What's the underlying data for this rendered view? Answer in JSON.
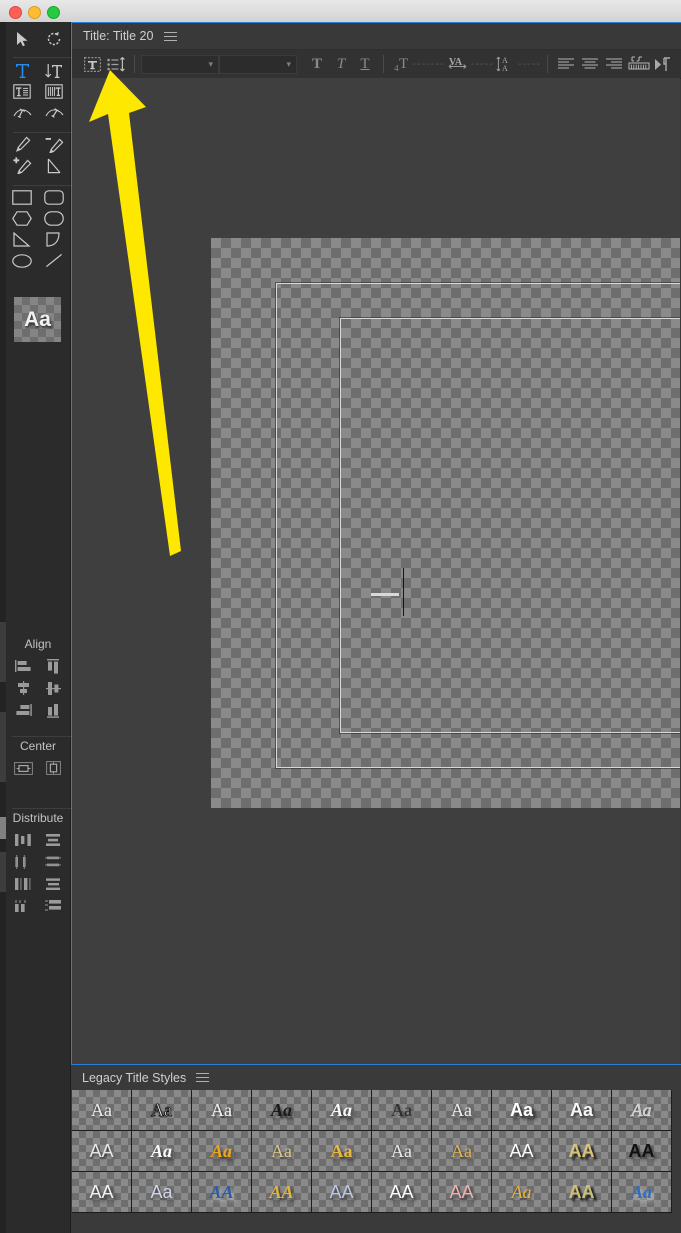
{
  "window": {
    "os_controls": [
      "close",
      "minimize",
      "zoom"
    ]
  },
  "titler": {
    "header": {
      "title": "Title: Title 20",
      "menu_icon": "hamburger-menu-icon"
    },
    "toolbar": {
      "buttons": [
        {
          "name": "title-tool-icon",
          "label": "T"
        },
        {
          "name": "tab-stops-icon",
          "label": ""
        }
      ],
      "font_family_value": "",
      "font_style_value": "",
      "bold_label": "T",
      "italic_label": "T",
      "underline_label": "T",
      "font_size_label": "T",
      "font_size_value": "-------",
      "kerning_label": "VA",
      "kerning_value": "-----",
      "leading_label": "A",
      "leading_value": "-----",
      "align_left": "align-left-icon",
      "align_center": "align-center-icon",
      "align_right": "align-right-icon",
      "tab_stops": "tab-stops-icon",
      "show_background_video": "show-background-video-icon"
    },
    "canvas": {
      "action_safe_guide": "action-safe-margin",
      "title_safe_guide": "title-safe-margin",
      "text_caret": "text-insertion-caret"
    }
  },
  "tools": {
    "rows": [
      [
        {
          "n": "selection-tool",
          "g": "arrow"
        },
        {
          "n": "rotation-tool",
          "g": "rotate"
        }
      ],
      [
        {
          "n": "type-tool",
          "g": "T",
          "sel": true
        },
        {
          "n": "vertical-type-tool",
          "g": "VT"
        }
      ],
      [
        {
          "n": "area-type-tool",
          "g": "boxT"
        },
        {
          "n": "vertical-area-type-tool",
          "g": "boxVT"
        }
      ],
      [
        {
          "n": "path-type-tool",
          "g": "pathT"
        },
        {
          "n": "vertical-path-type-tool",
          "g": "pathVT"
        }
      ],
      [
        {
          "n": "pen-tool",
          "g": "pen"
        },
        {
          "n": "delete-anchor-point-tool",
          "g": "penminus"
        }
      ],
      [
        {
          "n": "add-anchor-point-tool",
          "g": "penplus"
        },
        {
          "n": "convert-anchor-point-tool",
          "g": "convert"
        }
      ],
      [
        {
          "n": "rectangle-tool",
          "g": "rect"
        },
        {
          "n": "rounded-corner-rectangle-tool",
          "g": "roundrect"
        }
      ],
      [
        {
          "n": "clipped-corner-rectangle-tool",
          "g": "clipped"
        },
        {
          "n": "rounded-rectangle-tool",
          "g": "pill"
        }
      ],
      [
        {
          "n": "wedge-tool",
          "g": "wedge"
        },
        {
          "n": "arc-tool",
          "g": "arc"
        }
      ],
      [
        {
          "n": "ellipse-tool",
          "g": "ellipse"
        },
        {
          "n": "line-tool",
          "g": "line"
        }
      ]
    ],
    "preview_label": "Aa"
  },
  "panels": {
    "align": {
      "heading": "Align",
      "buttons": [
        "align-horizontal-left",
        "align-vertical-top",
        "align-horizontal-center",
        "align-vertical-center",
        "align-horizontal-right",
        "align-vertical-bottom"
      ]
    },
    "center": {
      "heading": "Center",
      "buttons": [
        "center-horizontally",
        "center-vertically"
      ]
    },
    "distribute": {
      "heading": "Distribute",
      "buttons": [
        "distribute-horizontal-left",
        "distribute-vertical-top",
        "distribute-horizontal-center",
        "distribute-vertical-center",
        "distribute-horizontal-right",
        "distribute-vertical-bottom",
        "distribute-horizontal-even",
        "distribute-vertical-even"
      ]
    }
  },
  "legacy_styles": {
    "title": "Legacy Title Styles",
    "menu_icon": "hamburger-menu-icon",
    "swatches": [
      {
        "label": "Aa",
        "color": "#ededed",
        "weight": "normal",
        "style": "normal",
        "family": "serif",
        "shadow": "1px 2px 2px rgba(0,0,0,.6)",
        "stroke": "none"
      },
      {
        "label": "Aa",
        "color": "#e8e8e8",
        "weight": "normal",
        "style": "normal",
        "family": "serif",
        "shadow": "0 0 2px #000",
        "stroke": "#000"
      },
      {
        "label": "Aa",
        "color": "#f4f4f4",
        "weight": "normal",
        "style": "normal",
        "family": "serif",
        "shadow": "2px 2px 1px rgba(0,0,0,.5)",
        "stroke": "none"
      },
      {
        "label": "Aa",
        "color": "#1a1a1a",
        "weight": "bold",
        "style": "italic",
        "family": "serif",
        "shadow": "2px 3px 2px rgba(0,0,0,.55)",
        "stroke": "none"
      },
      {
        "label": "Aa",
        "color": "#fafafa",
        "weight": "bold",
        "style": "italic",
        "family": "serif",
        "shadow": "2px 3px 3px rgba(0,0,0,.7)",
        "stroke": "none"
      },
      {
        "label": "Aa",
        "color": "#2a2a2a",
        "weight": "normal",
        "style": "normal",
        "family": "serif",
        "shadow": "2px 2px 2px rgba(0,0,0,.4)",
        "stroke": "none"
      },
      {
        "label": "Aa",
        "color": "#f0f0f0",
        "weight": "normal",
        "style": "normal",
        "family": "serif",
        "shadow": "2px 3px 3px rgba(0,0,0,.7)",
        "stroke": "none"
      },
      {
        "label": "Aa",
        "color": "#ffffff",
        "weight": "bold",
        "style": "normal",
        "family": "sans",
        "shadow": "3px 3px 3px rgba(0,0,0,.8)",
        "stroke": "none"
      },
      {
        "label": "Aa",
        "color": "#f6f6f6",
        "weight": "bold",
        "style": "normal",
        "family": "sans",
        "shadow": "2px 2px 2px rgba(0,0,0,.6)",
        "stroke": "none"
      },
      {
        "label": "Aa",
        "color": "#c8c8c8",
        "weight": "normal",
        "style": "italic",
        "family": "serif",
        "shadow": "1px 2px 2px rgba(0,0,0,.5)",
        "stroke": "#dcdcdc"
      },
      {
        "label": "AA",
        "color": "#e6e6e6",
        "weight": "normal",
        "style": "normal",
        "family": "sans",
        "shadow": "1px 2px 2px rgba(0,0,0,.5)",
        "stroke": "none"
      },
      {
        "label": "Aa",
        "color": "#fcfcfc",
        "weight": "bold",
        "style": "italic",
        "family": "serif",
        "shadow": "2px 3px 3px rgba(0,0,0,.7)",
        "stroke": "none"
      },
      {
        "label": "Aa",
        "color": "#f0a51e",
        "weight": "bold",
        "style": "italic",
        "family": "serif",
        "shadow": "2px 3px 4px rgba(0,0,0,.7)",
        "stroke": "none"
      },
      {
        "label": "Aa",
        "color": "#dfc98a",
        "weight": "normal",
        "style": "normal",
        "family": "serif",
        "shadow": "1px 2px 2px rgba(0,0,0,.5)",
        "stroke": "none"
      },
      {
        "label": "Aa",
        "color": "#e8b93c",
        "weight": "bold",
        "style": "normal",
        "family": "serif",
        "shadow": "2px 3px 3px rgba(0,0,0,.6)",
        "stroke": "none"
      },
      {
        "label": "Aa",
        "color": "#ececec",
        "weight": "normal",
        "style": "normal",
        "family": "serif",
        "shadow": "1px 2px 3px rgba(0,0,0,.6)",
        "stroke": "none"
      },
      {
        "label": "Aa",
        "color": "#e0b657",
        "weight": "normal",
        "style": "normal",
        "family": "serif",
        "shadow": "1px 2px 3px rgba(0,0,0,.6)",
        "stroke": "none"
      },
      {
        "label": "AA",
        "color": "#fbfbfb",
        "weight": "normal",
        "style": "normal",
        "family": "sans",
        "shadow": "2px 3px 3px rgba(0,0,0,.7)",
        "stroke": "none"
      },
      {
        "label": "AA",
        "color": "#d9c378",
        "weight": "bold",
        "style": "normal",
        "family": "sans",
        "shadow": "3px 3px 2px rgba(0,0,0,.85)",
        "stroke": "none"
      },
      {
        "label": "AA",
        "color": "#111111",
        "weight": "bold",
        "style": "normal",
        "family": "sans",
        "shadow": "2px 3px 3px rgba(0,0,0,.5)",
        "stroke": "none"
      },
      {
        "label": "AA",
        "color": "#f2f2f2",
        "weight": "normal",
        "style": "normal",
        "family": "sans",
        "shadow": "2px 3px 4px rgba(0,0,0,.75)",
        "stroke": "none"
      },
      {
        "label": "Aa",
        "color": "#cfd4e8",
        "weight": "normal",
        "style": "normal",
        "family": "sans",
        "shadow": "1px 2px 3px rgba(0,0,0,.5)",
        "stroke": "none"
      },
      {
        "label": "AA",
        "color": "#2a5ca8",
        "weight": "bold",
        "style": "italic",
        "family": "serif",
        "shadow": "2px 3px 4px rgba(255,255,255,.5)",
        "stroke": "none"
      },
      {
        "label": "AA",
        "color": "#e0b441",
        "weight": "bold",
        "style": "italic",
        "family": "serif",
        "shadow": "2px 3px 3px rgba(0,0,0,.55)",
        "stroke": "none"
      },
      {
        "label": "AA",
        "color": "#b9c6e4",
        "weight": "normal",
        "style": "normal",
        "family": "sans",
        "shadow": "2px 3px 3px rgba(0,0,0,.5)",
        "stroke": "none"
      },
      {
        "label": "AA",
        "color": "#fcfcfc",
        "weight": "normal",
        "style": "normal",
        "family": "sans",
        "shadow": "2px 3px 3px rgba(0,0,0,.7)",
        "stroke": "none"
      },
      {
        "label": "AA",
        "color": "#efb0b0",
        "weight": "normal",
        "style": "normal",
        "family": "sans",
        "shadow": "2px 3px 3px rgba(0,0,0,.6)",
        "stroke": "none"
      },
      {
        "label": "Aa",
        "color": "#ecb53f",
        "weight": "normal",
        "style": "italic",
        "family": "serif",
        "shadow": "1px 2px 2px rgba(0,0,0,.5)",
        "stroke": "none"
      },
      {
        "label": "AA",
        "color": "#cbbf7a",
        "weight": "bold",
        "style": "normal",
        "family": "sans",
        "shadow": "3px 3px 2px rgba(0,0,0,.9)",
        "stroke": "none"
      },
      {
        "label": "Aa",
        "color": "#2f6cc0",
        "weight": "bold",
        "style": "italic",
        "family": "serif",
        "shadow": "2px 3px 4px rgba(255,255,255,.55)",
        "stroke": "none"
      }
    ]
  },
  "annotation": {
    "arrow_color": "#ffe800",
    "points_at": "tab-stops-button"
  }
}
